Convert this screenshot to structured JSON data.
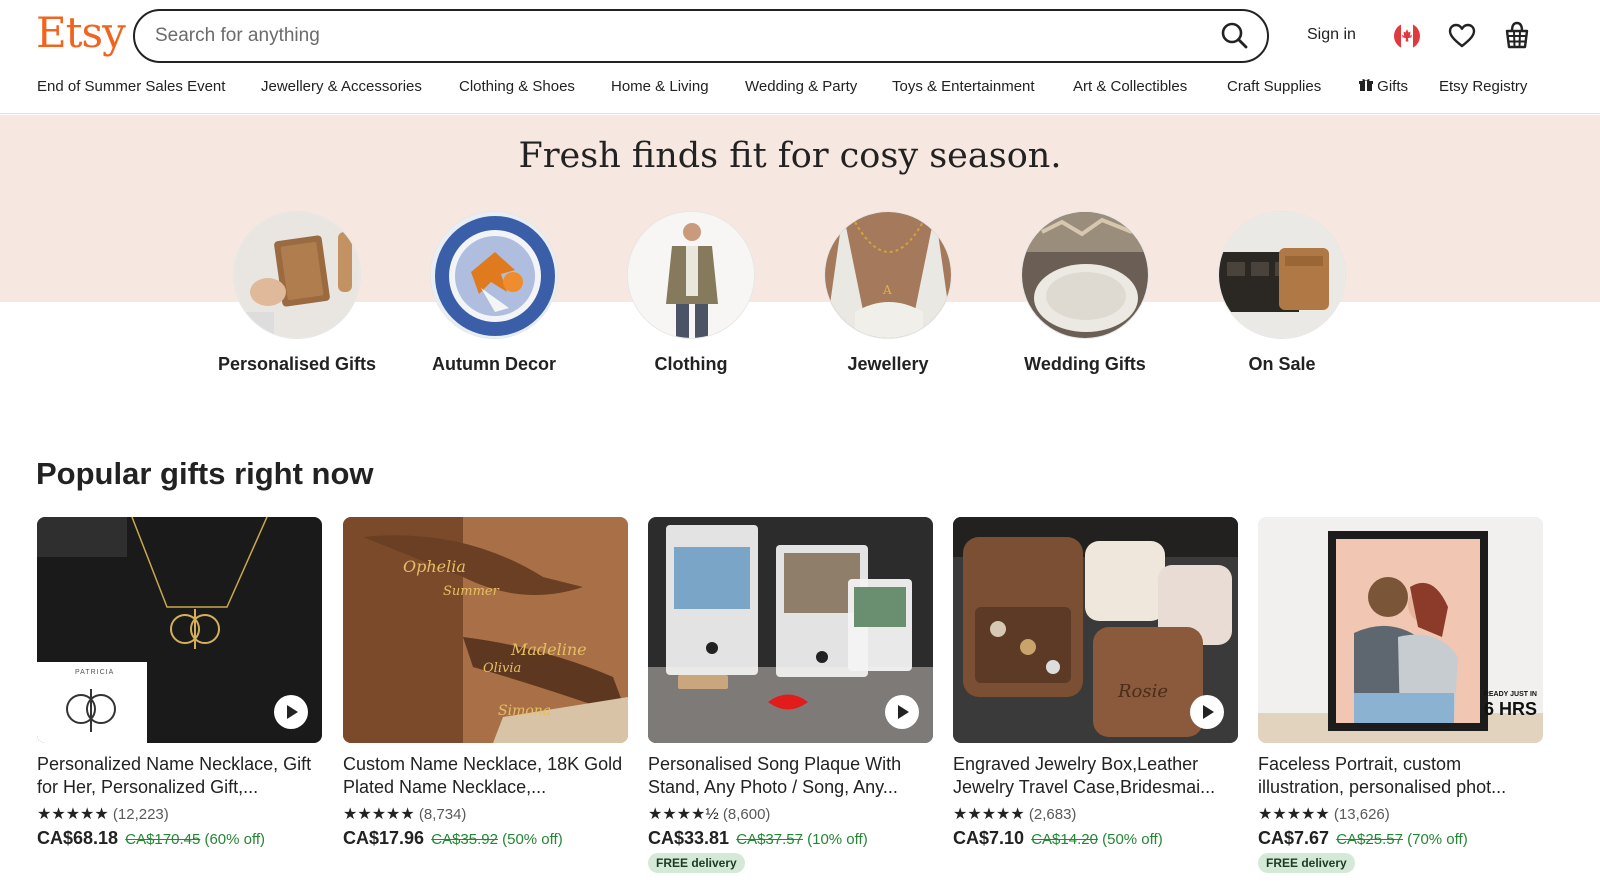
{
  "brand": {
    "logo_text": "Etsy",
    "accent": "#F1641E"
  },
  "search": {
    "placeholder": "Search for anything"
  },
  "header": {
    "sign_in": "Sign in"
  },
  "nav": {
    "items": [
      "End of Summer Sales Event",
      "Jewellery & Accessories",
      "Clothing & Shoes",
      "Home & Living",
      "Wedding & Party",
      "Toys & Entertainment",
      "Art & Collectibles",
      "Craft Supplies",
      "Gifts",
      "Etsy Registry"
    ]
  },
  "hero": {
    "title": "Fresh finds fit for cosy season.",
    "band_color": "#F7E7E1",
    "categories": [
      {
        "label": "Personalised Gifts"
      },
      {
        "label": "Autumn Decor"
      },
      {
        "label": "Clothing"
      },
      {
        "label": "Jewellery"
      },
      {
        "label": "Wedding Gifts"
      },
      {
        "label": "On Sale"
      }
    ]
  },
  "popular": {
    "title": "Popular gifts right now",
    "products": [
      {
        "title": "Personalized Name Necklace, Gift for Her, Personalized Gift,...",
        "stars": "★★★★★",
        "reviews": "(12,223)",
        "price": "CA$68.18",
        "original_price": "CA$170.45",
        "discount": "(60% off)",
        "badge": "",
        "thumb_label": "PATRICIA"
      },
      {
        "title": "Custom Name Necklace, 18K Gold Plated Name Necklace,...",
        "stars": "★★★★★",
        "reviews": "(8,734)",
        "price": "CA$17.96",
        "original_price": "CA$35.92",
        "discount": "(50% off)",
        "badge": ""
      },
      {
        "title": "Personalised Song Plaque With Stand, Any Photo / Song, Any...",
        "stars": "★★★★½",
        "reviews": "(8,600)",
        "price": "CA$33.81",
        "original_price": "CA$37.57",
        "discount": "(10% off)",
        "badge": "FREE delivery"
      },
      {
        "title": "Engraved Jewelry Box,Leather Jewelry Travel Case,Bridesmai...",
        "stars": "★★★★★",
        "reviews": "(2,683)",
        "price": "CA$7.10",
        "original_price": "CA$14.20",
        "discount": "(50% off)",
        "badge": ""
      },
      {
        "title": "Faceless Portrait, custom illustration, personalised phot...",
        "stars": "★★★★★",
        "reviews": "(13,626)",
        "price": "CA$7.67",
        "original_price": "CA$25.57",
        "discount": "(70% off)",
        "badge": "FREE delivery",
        "overlay_line1": "READY JUST IN",
        "overlay_line2": "6 HRS"
      }
    ]
  }
}
